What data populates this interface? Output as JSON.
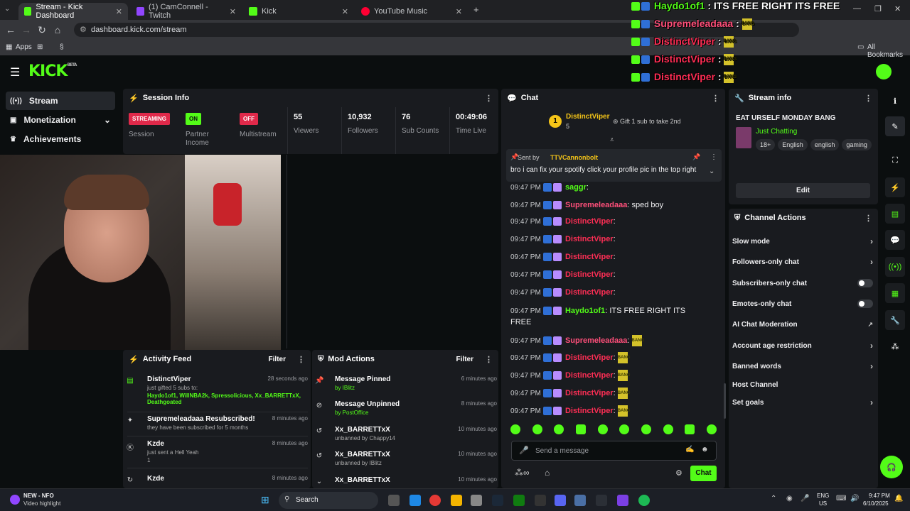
{
  "browser": {
    "tabs": [
      {
        "label": "Stream - Kick Dashboard",
        "active": true
      },
      {
        "label": "(1) CamConnell - Twitch"
      },
      {
        "label": "Kick"
      },
      {
        "label": "YouTube Music"
      }
    ],
    "url": "dashboard.kick.com/stream",
    "bookmarks": {
      "apps": "Apps",
      "all": "All Bookmarks"
    }
  },
  "app": {
    "logo": "KICK",
    "logo_tag": "BETA"
  },
  "sidebar": {
    "items": [
      {
        "label": "Stream"
      },
      {
        "label": "Monetization"
      },
      {
        "label": "Achievements"
      }
    ]
  },
  "session": {
    "title": "Session Info",
    "cells": [
      {
        "badge": "STREAMING",
        "label": "Session",
        "color": "#e0294a"
      },
      {
        "badge": "ON",
        "label": "Partner Income",
        "color": "#53fc18"
      },
      {
        "badge": "OFF",
        "label": "Multistream",
        "color": "#e0294a"
      },
      {
        "value": "55",
        "label": "Viewers"
      },
      {
        "value": "10,932",
        "label": "Followers"
      },
      {
        "value": "76",
        "label": "Sub Counts"
      },
      {
        "value": "00:49:06",
        "label": "Time Live"
      }
    ]
  },
  "activity": {
    "title": "Activity Feed",
    "filter": "Filter",
    "items": [
      {
        "user": "DistinctViper",
        "time": "28 seconds ago",
        "line1": "just gifted 5 subs to:",
        "line2": "Haydo1of1, WillNBA2k, Spressolicious, Xx_BARRETTxX, Deathgoated"
      },
      {
        "user": "Supremeleadaaa Resubscribed!",
        "time": "8 minutes ago",
        "line1": "they have been subscribed for 5 months"
      },
      {
        "user": "Kzde",
        "time": "8 minutes ago",
        "line1": "just sent a Hell Yeah",
        "line2": "1"
      },
      {
        "user": "Kzde",
        "time": "8 minutes ago"
      }
    ]
  },
  "mod": {
    "title": "Mod Actions",
    "filter": "Filter",
    "items": [
      {
        "title": "Message Pinned",
        "by": "by IBlitz",
        "time": "6 minutes ago"
      },
      {
        "title": "Message Unpinned",
        "by": "by PostOffice",
        "time": "8 minutes ago"
      },
      {
        "title": "Xx_BARRETTxX",
        "by": "unbanned by Chappy14",
        "time": "10 minutes ago"
      },
      {
        "title": "Xx_BARRETTxX",
        "by": "unbanned by IBlitz",
        "time": "10 minutes ago"
      },
      {
        "title": "Xx_BARRETTxX",
        "time": "10 minutes ago"
      }
    ]
  },
  "chat": {
    "title": "Chat",
    "gifter": {
      "rank": "1",
      "name": "DistinctViper",
      "count": "5",
      "note": "Gift 1 sub to take 2nd"
    },
    "pinned": {
      "sent_by": "Sent by",
      "author": "TTVCannonbolt",
      "text": "bro i can fix your spotify click your profile pic in the top right"
    },
    "messages": [
      {
        "time": "09:47 PM",
        "user": "saggr",
        "color": "#53fc18",
        "text": ""
      },
      {
        "time": "09:47 PM",
        "user": "Supremeleadaaa",
        "color": "#ff4f7a",
        "text": "sped boy"
      },
      {
        "time": "09:47 PM",
        "user": "DistinctViper",
        "color": "#ff2e55",
        "text": ""
      },
      {
        "time": "09:47 PM",
        "user": "DistinctViper",
        "color": "#ff2e55",
        "text": ""
      },
      {
        "time": "09:47 PM",
        "user": "DistinctViper",
        "color": "#ff2e55",
        "text": ""
      },
      {
        "time": "09:47 PM",
        "user": "DistinctViper",
        "color": "#ff2e55",
        "text": ""
      },
      {
        "time": "09:47 PM",
        "user": "DistinctViper",
        "color": "#ff2e55",
        "text": ""
      },
      {
        "time": "09:47 PM",
        "user": "Haydo1of1",
        "color": "#53fc18",
        "text": "ITS FREE RIGHT ITS",
        "text2": "FREE"
      },
      {
        "time": "09:47 PM",
        "user": "Supremeleadaaa",
        "color": "#ff4f7a",
        "text": "BANG"
      },
      {
        "time": "09:47 PM",
        "user": "DistinctViper",
        "color": "#ff2e55",
        "text": "BANG"
      },
      {
        "time": "09:47 PM",
        "user": "DistinctViper",
        "color": "#ff2e55",
        "text": "BANG"
      },
      {
        "time": "09:47 PM",
        "user": "DistinctViper",
        "color": "#ff2e55",
        "text": "BANG"
      },
      {
        "time": "09:47 PM",
        "user": "DistinctViper",
        "color": "#ff2e55",
        "text": "BANG"
      }
    ],
    "input_placeholder": "Send a message",
    "send_label": "Chat"
  },
  "overlay": [
    {
      "user": "Haydo1of1",
      "text": "ITS FREE RIGHT ITS FREE",
      "color": "#53fc18"
    },
    {
      "user": "Supremeleadaaa",
      "text": "BANG",
      "color": "#ff4f7a"
    },
    {
      "user": "DistinctViper",
      "text": "BANG",
      "color": "#ff2e55"
    },
    {
      "user": "DistinctViper",
      "text": "BANG",
      "color": "#ff2e55"
    },
    {
      "user": "DistinctViper",
      "text": "BANG",
      "color": "#ff2e55"
    }
  ],
  "stream_info": {
    "title": "Stream info",
    "stream_title": "EAT URSELF MONDAY BANG",
    "category": "Just Chatting",
    "tags": [
      "18+",
      "English",
      "english",
      "gaming"
    ],
    "edit_label": "Edit"
  },
  "channel_actions": {
    "title": "Channel Actions",
    "items": [
      {
        "label": "Slow mode",
        "kind": "chevron"
      },
      {
        "label": "Followers-only chat",
        "kind": "chevron"
      },
      {
        "label": "Subscribers-only chat",
        "kind": "toggle"
      },
      {
        "label": "Emotes-only chat",
        "kind": "toggle"
      },
      {
        "label": "AI Chat Moderation",
        "kind": "external"
      },
      {
        "label": "Account age restriction",
        "kind": "chevron"
      },
      {
        "label": "Banned words",
        "kind": "chevron"
      },
      {
        "label": "Host Channel",
        "kind": "none"
      },
      {
        "label": "Set goals",
        "kind": "chevron"
      }
    ]
  },
  "taskbar": {
    "notif_title": "NEW - NFO",
    "notif_sub": "Video highlight",
    "search": "Search",
    "lang": "ENG",
    "region": "US",
    "time": "9:47 PM",
    "date": "6/10/2025"
  },
  "colors": {
    "brand": "#53fc18",
    "panel": "#191b1f",
    "bg": "#0b0e0f"
  }
}
